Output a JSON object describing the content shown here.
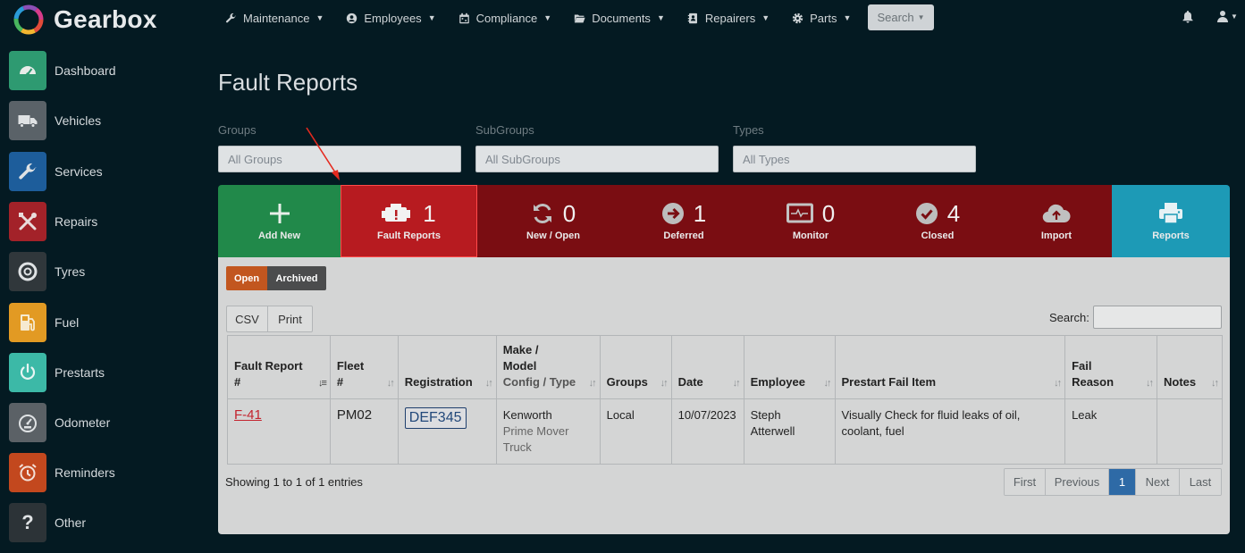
{
  "app": {
    "name": "Gearbox"
  },
  "nav": {
    "items": [
      {
        "label": "Maintenance",
        "icon": "wrench-icon"
      },
      {
        "label": "Employees",
        "icon": "user-circle-icon"
      },
      {
        "label": "Compliance",
        "icon": "calendar-icon"
      },
      {
        "label": "Documents",
        "icon": "folder-icon"
      },
      {
        "label": "Repairers",
        "icon": "contact-book-icon"
      },
      {
        "label": "Parts",
        "icon": "gear-icon"
      }
    ],
    "search_label": "Search"
  },
  "sidebar": {
    "items": [
      {
        "label": "Dashboard",
        "icon": "dashboard-gauge-icon",
        "color": "#2e9a71"
      },
      {
        "label": "Vehicles",
        "icon": "truck-icon",
        "color": "#5a6268"
      },
      {
        "label": "Services",
        "icon": "wrench-icon",
        "color": "#1d5d9b"
      },
      {
        "label": "Repairs",
        "icon": "tools-icon",
        "color": "#a32229"
      },
      {
        "label": "Tyres",
        "icon": "tyre-icon",
        "color": "#30373b"
      },
      {
        "label": "Fuel",
        "icon": "fuel-pump-icon",
        "color": "#e29a23"
      },
      {
        "label": "Prestarts",
        "icon": "power-icon",
        "color": "#3cb9a7"
      },
      {
        "label": "Odometer",
        "icon": "odometer-icon",
        "color": "#5b6166"
      },
      {
        "label": "Reminders",
        "icon": "alarm-clock-icon",
        "color": "#c3481e"
      },
      {
        "label": "Other",
        "icon": "question-icon",
        "color": "#2c3337"
      }
    ]
  },
  "page": {
    "title": "Fault Reports"
  },
  "filters": {
    "groups_label": "Groups",
    "groups_value": "All Groups",
    "subgroups_label": "SubGroups",
    "subgroups_value": "All SubGroups",
    "types_label": "Types",
    "types_value": "All Types"
  },
  "tiles": {
    "add_new": "Add New",
    "fault_reports": {
      "count": "1",
      "label": "Fault Reports"
    },
    "new_open": {
      "count": "0",
      "label": "New / Open"
    },
    "deferred": {
      "count": "1",
      "label": "Deferred"
    },
    "monitor": {
      "count": "0",
      "label": "Monitor"
    },
    "closed": {
      "count": "4",
      "label": "Closed"
    },
    "import": "Import",
    "reports": "Reports"
  },
  "colors": {
    "green": "#21894a",
    "red": "#7a0d12",
    "active_red": "#b71b20",
    "teal": "#1d9ab6",
    "open_orange": "#c2561f"
  },
  "toggle": {
    "open": "Open",
    "archived": "Archived"
  },
  "tools": {
    "csv": "CSV",
    "print": "Print",
    "search_label": "Search:"
  },
  "table": {
    "headers": {
      "fault_report": [
        "Fault Report",
        "#"
      ],
      "fleet": [
        "Fleet",
        "#"
      ],
      "registration": "Registration",
      "make_model": [
        "Make /",
        "Model"
      ],
      "make_model_sub": "Config / Type",
      "groups": "Groups",
      "date": "Date",
      "employee": "Employee",
      "prestart_fail_item": "Prestart Fail Item",
      "fail_reason": [
        "Fail",
        "Reason"
      ],
      "notes": "Notes"
    },
    "rows": [
      {
        "fault_report": "F-41",
        "fleet": "PM02",
        "registration": "DEF345",
        "make": "Kenworth",
        "config_type": [
          "Prime Mover",
          "Truck"
        ],
        "groups": "Local",
        "date": "10/07/2023",
        "employee": [
          "Steph",
          "Atterwell"
        ],
        "prestart_fail_item": [
          "Visually Check for fluid leaks of oil,",
          "coolant, fuel"
        ],
        "fail_reason": "Leak",
        "notes": ""
      }
    ]
  },
  "footer": {
    "info": "Showing 1 to 1 of 1 entries"
  },
  "pagination": {
    "first": "First",
    "previous": "Previous",
    "current": "1",
    "next": "Next",
    "last": "Last"
  }
}
